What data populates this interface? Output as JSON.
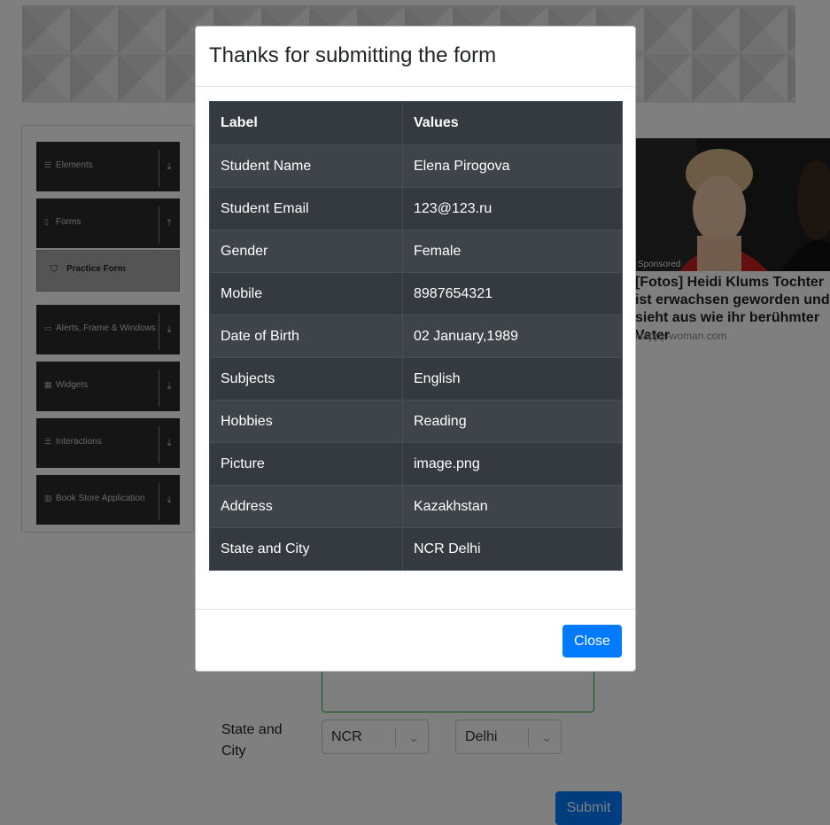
{
  "sidebar": {
    "groups": [
      {
        "label": "Elements",
        "icon": "list-icon",
        "arrow": "chevron-down"
      },
      {
        "label": "Forms",
        "icon": "document-icon",
        "arrow": "chevron-up"
      },
      {
        "label": "Alerts, Frame & Windows",
        "icon": "window-icon",
        "arrow": "chevron-down"
      },
      {
        "label": "Widgets",
        "icon": "grid-icon",
        "arrow": "chevron-down"
      },
      {
        "label": "Interactions",
        "icon": "list-icon",
        "arrow": "chevron-down"
      },
      {
        "label": "Book Store Application",
        "icon": "books-icon",
        "arrow": "chevron-down"
      }
    ],
    "active_item": {
      "label": "Practice Form",
      "icon": "html5-icon"
    }
  },
  "form": {
    "state_city_label": "State and City",
    "state_value": "NCR",
    "city_value": "Delhi",
    "submit_label": "Submit"
  },
  "ad": {
    "sponsored": "Sponsored",
    "headline": "[Fotos] Heidi Klums Tochter ist erwachsen geworden und sieht aus wie ihr berühmter Vater",
    "source": "Happy-woman.com"
  },
  "modal": {
    "title": "Thanks for submitting the form",
    "headers": [
      "Label",
      "Values"
    ],
    "rows": [
      [
        "Student Name",
        "Elena Pirogova"
      ],
      [
        "Student Email",
        "123@123.ru"
      ],
      [
        "Gender",
        "Female"
      ],
      [
        "Mobile",
        "8987654321"
      ],
      [
        "Date of Birth",
        "02 January,1989"
      ],
      [
        "Subjects",
        "English"
      ],
      [
        "Hobbies",
        "Reading"
      ],
      [
        "Picture",
        "image.png"
      ],
      [
        "Address",
        "Kazakhstan"
      ],
      [
        "State and City",
        "NCR Delhi"
      ]
    ],
    "close_label": "Close"
  },
  "colors": {
    "primary": "#007bff",
    "table_dark": "#343a40",
    "overlay": "rgba(0,0,0,0.5)"
  }
}
